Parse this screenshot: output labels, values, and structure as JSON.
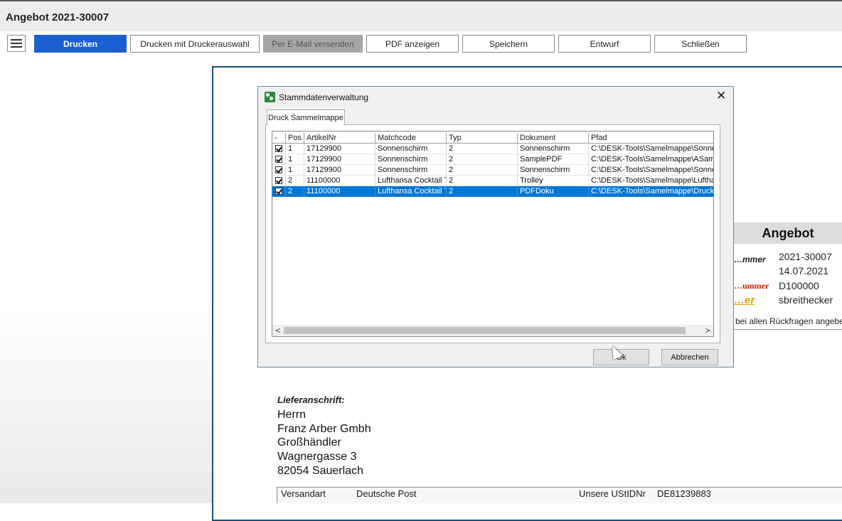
{
  "window": {
    "title": "Angebot 2021-30007"
  },
  "toolbar": {
    "menu_icon": "hamburger-icon",
    "buttons": [
      {
        "label": "Drucken",
        "state": "primary"
      },
      {
        "label": "Drucken mit Druckerauswahl",
        "state": "normal"
      },
      {
        "label": "Per E-Mail versenden",
        "state": "disabled"
      },
      {
        "label": "PDF anzeigen",
        "state": "normal"
      },
      {
        "label": "Speichern",
        "state": "normal"
      },
      {
        "label": "Entwurf",
        "state": "normal"
      },
      {
        "label": "Schließen",
        "state": "normal"
      }
    ]
  },
  "document": {
    "heading": "Angebot",
    "fields": [
      {
        "label": "…mmer",
        "value": "2021-30007",
        "label_color": "#111111"
      },
      {
        "label": "",
        "value": "14.07.2021",
        "label_color": "#111111"
      },
      {
        "label": "…ummer",
        "value": "D100000",
        "label_color": "#cc2200"
      },
      {
        "label": "…er",
        "value": "sbreithecker",
        "label_color": "#e0a000"
      }
    ],
    "note": "bei allen Rückfragen angebe",
    "delivery": {
      "title": "Lieferanschrift:",
      "lines": [
        "Herrn",
        "Franz Arber Gmbh",
        "Großhändler",
        "Wagnergasse 3",
        "82054 Sauerlach"
      ]
    },
    "shipping": {
      "label": "Versandart",
      "value": "Deutsche Post",
      "vat_label": "Unsere UStIDNr",
      "vat_value": "DE81239883"
    }
  },
  "dialog": {
    "title": "Stammdatenverwaltung",
    "icon": "app-icon",
    "close_icon": "close-icon",
    "close_glyph": "✕",
    "tab": "Druck Sammelmappe",
    "columns": [
      "-",
      "Pos",
      "ArtikelNr",
      "Matchcode",
      "Typ",
      "Dokument",
      "Pfad"
    ],
    "rows": [
      {
        "checked": true,
        "pos": "1",
        "artikel": "17129900",
        "matchcode": "Sonnenschirm",
        "typ": "2",
        "dokument": "Sonnenschirm",
        "pfad": "C:\\DESK-Tools\\Samelmappe\\Sonne",
        "selected": false
      },
      {
        "checked": true,
        "pos": "1",
        "artikel": "17129900",
        "matchcode": "Sonnenschirm",
        "typ": "2",
        "dokument": "SamplePDF",
        "pfad": "C:\\DESK-Tools\\Samelmappe\\ASam",
        "selected": false
      },
      {
        "checked": true,
        "pos": "1",
        "artikel": "17129900",
        "matchcode": "Sonnenschirm",
        "typ": "2",
        "dokument": "Sonnenschirm",
        "pfad": "C:\\DESK-Tools\\Samelmappe\\Sonne",
        "selected": false
      },
      {
        "checked": true,
        "pos": "2",
        "artikel": "11100000",
        "matchcode": "Lufthansa Cocktail T",
        "typ": "2",
        "dokument": "Trolley",
        "pfad": "C:\\DESK-Tools\\Samelmappe\\Luftha",
        "selected": false
      },
      {
        "checked": true,
        "pos": "2",
        "artikel": "11100000",
        "matchcode": "Lufthansa Cocktail T",
        "typ": "2",
        "dokument": "PDFDoku",
        "pfad": "C:\\DESK-Tools\\Samelmappe\\Druck",
        "selected": true
      }
    ],
    "scroll_left": "<",
    "scroll_right": ">",
    "ok_label": "Ok",
    "cancel_label": "Abbrechen"
  }
}
